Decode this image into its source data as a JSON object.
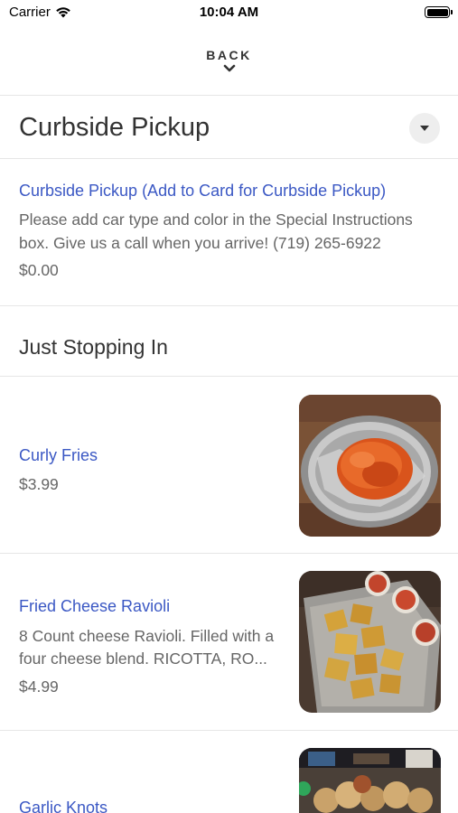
{
  "status_bar": {
    "carrier": "Carrier",
    "time": "10:04 AM"
  },
  "nav": {
    "back_label": "BACK"
  },
  "category": {
    "title": "Curbside Pickup"
  },
  "curbside_item": {
    "name": "Curbside Pickup (Add to Card for Curbside Pickup)",
    "description_line1": "Please add car type and color in the Special Instructions",
    "description_line2": "box. Give us a call when you arrive! (719) 265-6922",
    "price": "$0.00"
  },
  "section": {
    "title": "Just Stopping In"
  },
  "menu_items": [
    {
      "name": "Curly Fries",
      "price": "$3.99",
      "image": "curly-fries-photo"
    },
    {
      "name": "Fried Cheese Ravioli",
      "description_line1": "8 Count cheese Ravioli. Filled with a",
      "description_line2": "four cheese  blend. RICOTTA, RO...",
      "price": "$4.99",
      "image": "fried-ravioli-photo"
    },
    {
      "name": "Garlic Knots",
      "image": "garlic-knots-photo"
    }
  ],
  "colors": {
    "link": "#3b58c4",
    "text": "#333333",
    "muted": "#666666",
    "divider": "#e6e6e6"
  }
}
